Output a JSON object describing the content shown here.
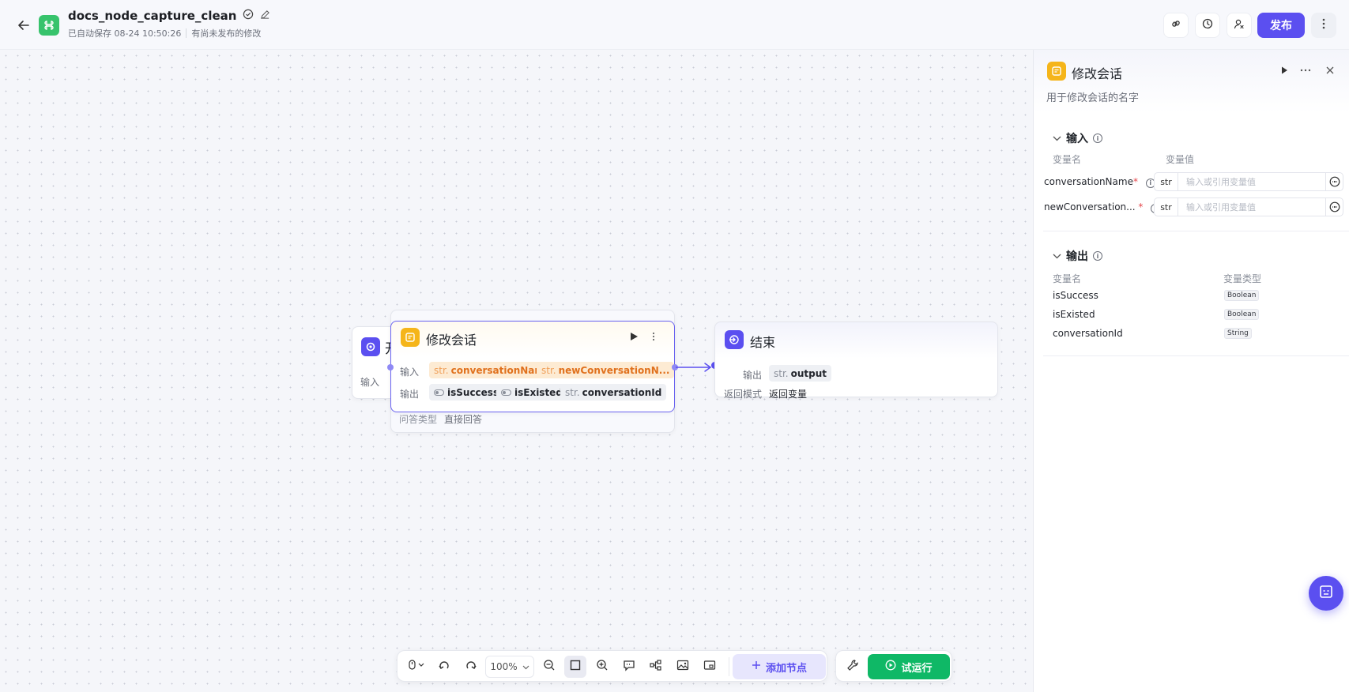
{
  "header": {
    "title": "docs_node_capture_clean",
    "autosave": "已自动保存 08-24 10:50:26",
    "unpublished": "有尚未发布的修改",
    "publish_label": "发布"
  },
  "canvas": {
    "start_node": {
      "title_fragment": "开",
      "input_label": "输入"
    },
    "bg_node": {
      "qa_type_label": "问答类型",
      "qa_type_value": "直接回答"
    },
    "modify_node": {
      "title": "修改会话",
      "input_label": "输入",
      "output_label": "输出",
      "inputs": [
        {
          "type": "str.",
          "name": "conversationName"
        },
        {
          "type": "str.",
          "name": "newConversationN..."
        }
      ],
      "outputs": [
        {
          "type": "bool",
          "name": "isSuccess"
        },
        {
          "type": "bool",
          "name": "isExisted"
        },
        {
          "type": "str.",
          "name": "conversationId"
        }
      ]
    },
    "end_node": {
      "title": "结束",
      "output_label": "输出",
      "output_type": "str.",
      "output_name": "output",
      "return_mode_label": "返回模式",
      "return_mode_value": "返回变量"
    }
  },
  "toolbar": {
    "zoom": "100%",
    "add_node_label": "添加节点",
    "test_run_label": "试运行"
  },
  "panel": {
    "title": "修改会话",
    "description": "用于修改会话的名字",
    "input_section": {
      "title": "输入",
      "col_name": "变量名",
      "col_value": "变量值",
      "rows": [
        {
          "name": "conversationName",
          "type": "str",
          "placeholder": "输入或引用变量值"
        },
        {
          "name": "newConversation...",
          "type": "str",
          "placeholder": "输入或引用变量值"
        }
      ]
    },
    "output_section": {
      "title": "输出",
      "col_name": "变量名",
      "col_type": "变量类型",
      "rows": [
        {
          "name": "isSuccess",
          "type": "Boolean"
        },
        {
          "name": "isExisted",
          "type": "Boolean"
        },
        {
          "name": "conversationId",
          "type": "String"
        }
      ]
    }
  },
  "colors": {
    "accent": "#5b4ff0",
    "run_green": "#0fb866",
    "node_yellow": "#f5b51a",
    "node_purple": "#5b4ff0"
  }
}
